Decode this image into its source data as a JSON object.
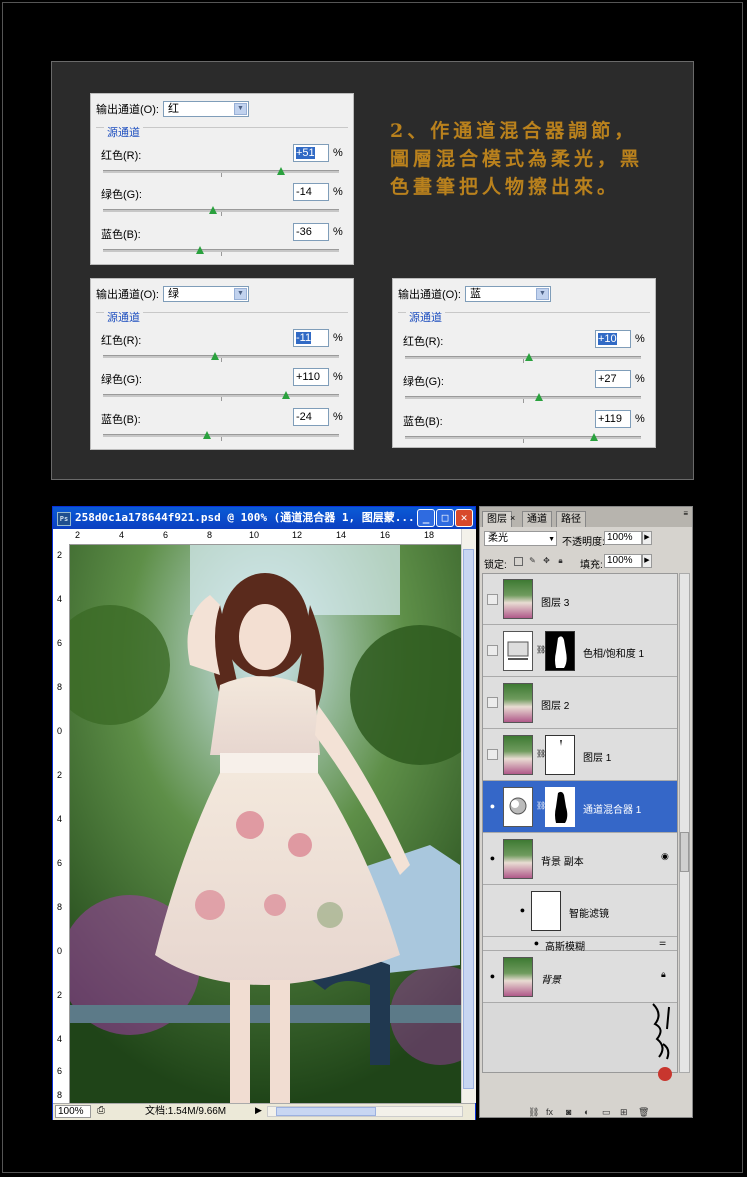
{
  "mixers": [
    {
      "output_label": "输出通道(O):",
      "output_value": "红",
      "source_label": "源通道",
      "channels": [
        {
          "label": "红色(R):",
          "value": "+51",
          "highlight": true,
          "level": 0.755
        },
        {
          "label": "绿色(G):",
          "value": "-14",
          "highlight": false,
          "level": 0.465
        },
        {
          "label": "蓝色(B):",
          "value": "-36",
          "highlight": false,
          "level": 0.41
        }
      ],
      "pct": "%"
    },
    {
      "output_label": "输出通道(O):",
      "output_value": "绿",
      "source_label": "源通道",
      "channels": [
        {
          "label": "红色(R):",
          "value": "-11",
          "highlight": true,
          "level": 0.473
        },
        {
          "label": "绿色(G):",
          "value": "+110",
          "highlight": false,
          "level": 0.775
        },
        {
          "label": "蓝色(B):",
          "value": "-24",
          "highlight": false,
          "level": 0.44
        }
      ],
      "pct": "%"
    },
    {
      "output_label": "输出通道(O):",
      "output_value": "蓝",
      "source_label": "源通道",
      "channels": [
        {
          "label": "红色(R):",
          "value": "+10",
          "highlight": true,
          "level": 0.525
        },
        {
          "label": "绿色(G):",
          "value": "+27",
          "highlight": false,
          "level": 0.568
        },
        {
          "label": "蓝色(B):",
          "value": "+119",
          "highlight": false,
          "level": 0.8
        }
      ],
      "pct": "%"
    }
  ],
  "note_text": "2、作通道混合器調節，圖層混合模式為柔光，黑色畫筆把人物擦出來。",
  "document": {
    "title": "258d0c1a178644f921.psd @ 100% (通道混合器 1, 图层蒙...",
    "zoom": "100%",
    "doc_info": "文档:1.54M/9.66M",
    "ruler_h": [
      "2",
      "4",
      "6",
      "8",
      "10",
      "12",
      "14",
      "16",
      "18"
    ],
    "ruler_v": [
      "2",
      "4",
      "6",
      "8",
      "0",
      "2",
      "4",
      "6",
      "8",
      "0",
      "2",
      "4",
      "6",
      "8"
    ]
  },
  "layers_panel": {
    "tabs": [
      "图层",
      "通道",
      "路径"
    ],
    "blend_mode": "柔光",
    "opacity_label": "不透明度:",
    "opacity_value": "100%",
    "lock_label": "锁定:",
    "fill_label": "填充:",
    "fill_value": "100%",
    "layers": [
      {
        "name": "图层 3",
        "visible": false,
        "selected": false
      },
      {
        "name": "色相/饱和度 1",
        "visible": false,
        "selected": false
      },
      {
        "name": "图层 2",
        "visible": false,
        "selected": false
      },
      {
        "name": "图层 1",
        "visible": false,
        "selected": false
      },
      {
        "name": "通道混合器 1",
        "visible": true,
        "selected": true
      },
      {
        "name": "背景 副本",
        "visible": true,
        "selected": false
      },
      {
        "name": "智能滤镜",
        "visible": true,
        "selected": false
      },
      {
        "name": "高斯模糊",
        "visible": true,
        "selected": false
      },
      {
        "name": "背景",
        "visible": true,
        "selected": false
      }
    ]
  }
}
